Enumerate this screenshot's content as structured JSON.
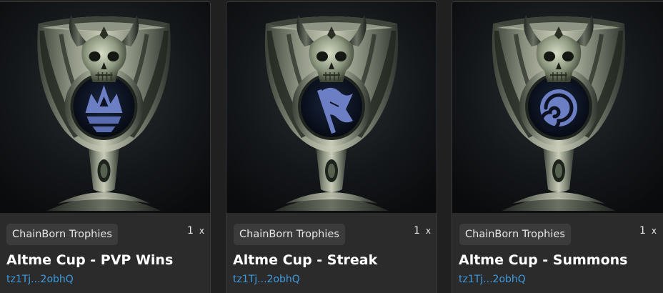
{
  "cards": [
    {
      "collection": "ChainBorn Trophies",
      "quantity": "1",
      "quantity_suffix": "x",
      "title": "Altme Cup - PVP Wins",
      "owner": "tz1Tj...2obhQ",
      "emblem_icon": "crown-icon"
    },
    {
      "collection": "ChainBorn Trophies",
      "quantity": "1",
      "quantity_suffix": "x",
      "title": "Altme Cup - Streak",
      "owner": "tz1Tj...2obhQ",
      "emblem_icon": "flag-icon"
    },
    {
      "collection": "ChainBorn Trophies",
      "quantity": "1",
      "quantity_suffix": "x",
      "title": "Altme Cup - Summons",
      "owner": "tz1Tj...2obhQ",
      "emblem_icon": "swirl-icon"
    }
  ],
  "colors": {
    "card_background": "#2b2b2b",
    "tag_background": "#3b3b3b",
    "owner_link": "#3d9be0",
    "emblem_blue": "#6c7fc4"
  }
}
